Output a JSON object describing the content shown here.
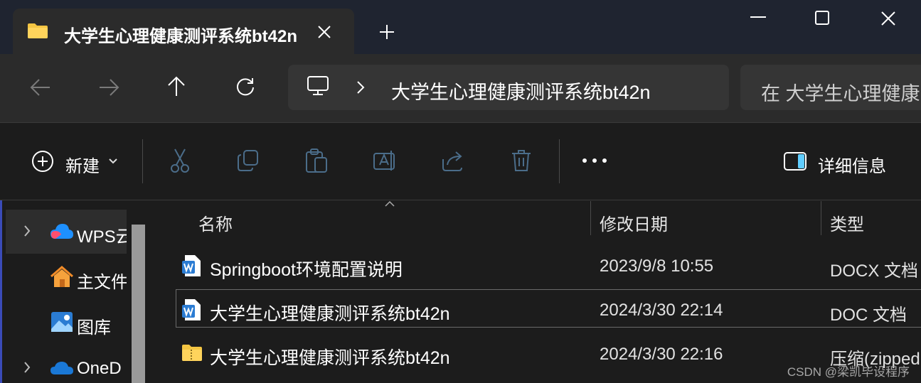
{
  "window": {
    "tab_title": "大学生心理健康测评系统bt42n"
  },
  "address_bar": {
    "path": "大学生心理健康测评系统bt42n"
  },
  "search": {
    "placeholder": "在 大学生心理健康"
  },
  "toolbar": {
    "new_label": "新建",
    "details_label": "详细信息"
  },
  "sidebar": {
    "items": [
      {
        "label": "WPS云",
        "icon": "wps-cloud-icon",
        "expandable": true
      },
      {
        "label": "主文件",
        "icon": "home-icon",
        "expandable": false
      },
      {
        "label": "图库",
        "icon": "gallery-icon",
        "expandable": false
      },
      {
        "label": "OneD",
        "icon": "onedrive-icon",
        "expandable": true
      }
    ]
  },
  "file_list": {
    "columns": [
      "名称",
      "修改日期",
      "类型"
    ],
    "rows": [
      {
        "name": "Springboot环境配置说明",
        "modified": "2023/9/8 10:55",
        "type": "DOCX 文档",
        "icon": "word-doc-icon"
      },
      {
        "name": "大学生心理健康测评系统bt42n",
        "modified": "2024/3/30 22:14",
        "type": "DOC 文档",
        "icon": "word-doc-icon"
      },
      {
        "name": "大学生心理健康测评系统bt42n",
        "modified": "2024/3/30 22:16",
        "type": "压缩(zipped",
        "icon": "zip-folder-icon"
      }
    ]
  },
  "watermark": "CSDN @梁凯毕设程序",
  "colors": {
    "titlebar_bg": "#1f2430",
    "panel_bg": "#2b2b2b",
    "content_bg": "#1c1c1c",
    "folder_yellow": "#f4c542",
    "word_blue": "#2b7cd3"
  }
}
